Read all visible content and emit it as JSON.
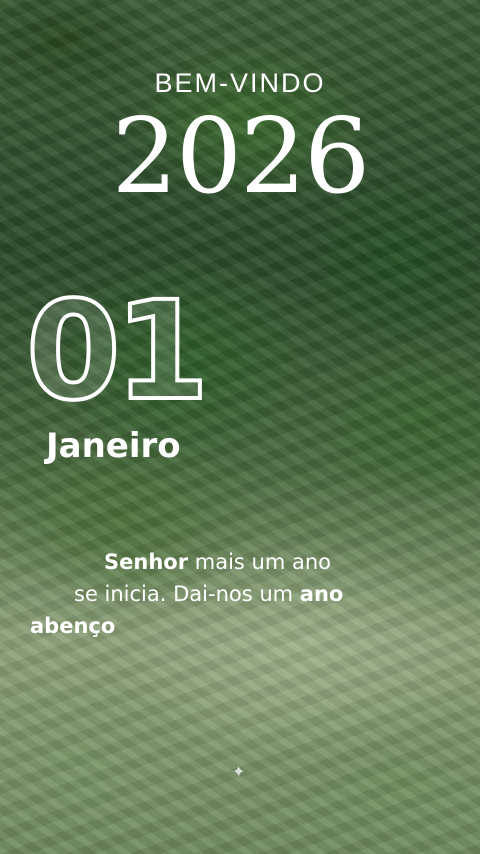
{
  "header": {
    "welcome": "BEM-VINDO",
    "year": "2026"
  },
  "date": {
    "day": "01",
    "month": "Janeiro"
  },
  "message": {
    "line1": [
      {
        "text": "Senhor",
        "bold": true
      },
      {
        "text": " mais um ano",
        "bold": false
      }
    ],
    "line2": [
      {
        "text": "se inicia. Dai-nos um ",
        "bold": false
      },
      {
        "text": "ano",
        "bold": true
      }
    ],
    "line3": [
      {
        "text": "abenço",
        "bold": true
      }
    ]
  },
  "decor": {
    "sparkle_icon": "✦"
  }
}
